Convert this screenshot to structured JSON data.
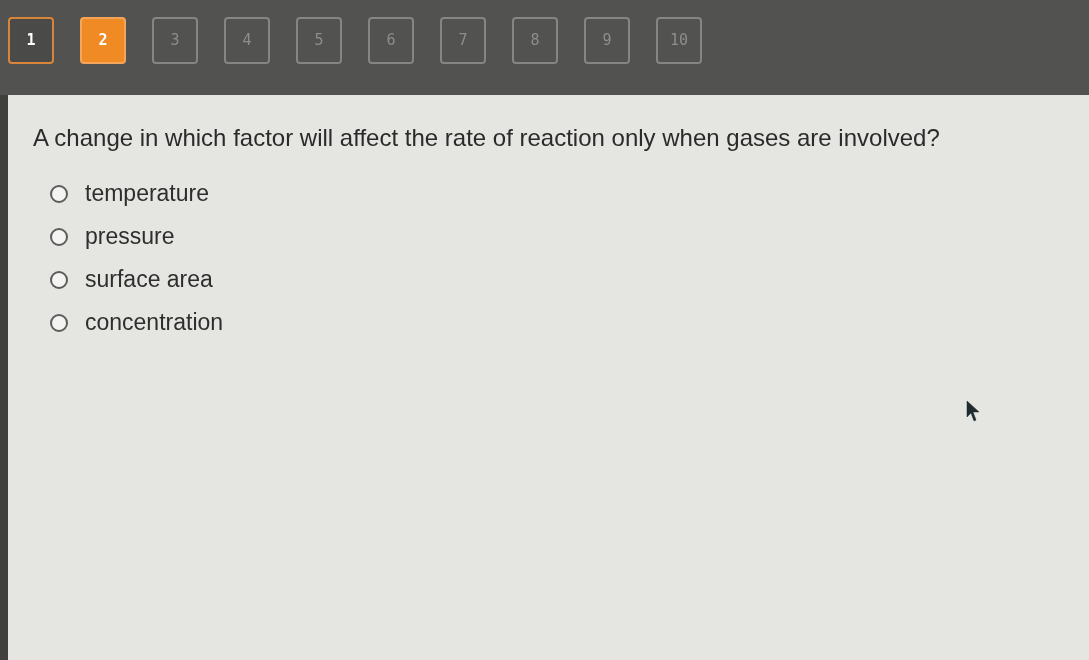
{
  "question_nav": [
    {
      "label": "1",
      "selected": false,
      "visited": true
    },
    {
      "label": "2",
      "selected": true,
      "visited": true
    },
    {
      "label": "3",
      "selected": false,
      "visited": false
    },
    {
      "label": "4",
      "selected": false,
      "visited": false
    },
    {
      "label": "5",
      "selected": false,
      "visited": false
    },
    {
      "label": "6",
      "selected": false,
      "visited": false
    },
    {
      "label": "7",
      "selected": false,
      "visited": false
    },
    {
      "label": "8",
      "selected": false,
      "visited": false
    },
    {
      "label": "9",
      "selected": false,
      "visited": false
    },
    {
      "label": "10",
      "selected": false,
      "visited": false
    }
  ],
  "question": {
    "text": "A change in which factor will affect the rate of reaction only when gases are involved?",
    "options": [
      {
        "label": "temperature",
        "selected": false
      },
      {
        "label": "pressure",
        "selected": false
      },
      {
        "label": "surface area",
        "selected": false
      },
      {
        "label": "concentration",
        "selected": false
      }
    ]
  }
}
